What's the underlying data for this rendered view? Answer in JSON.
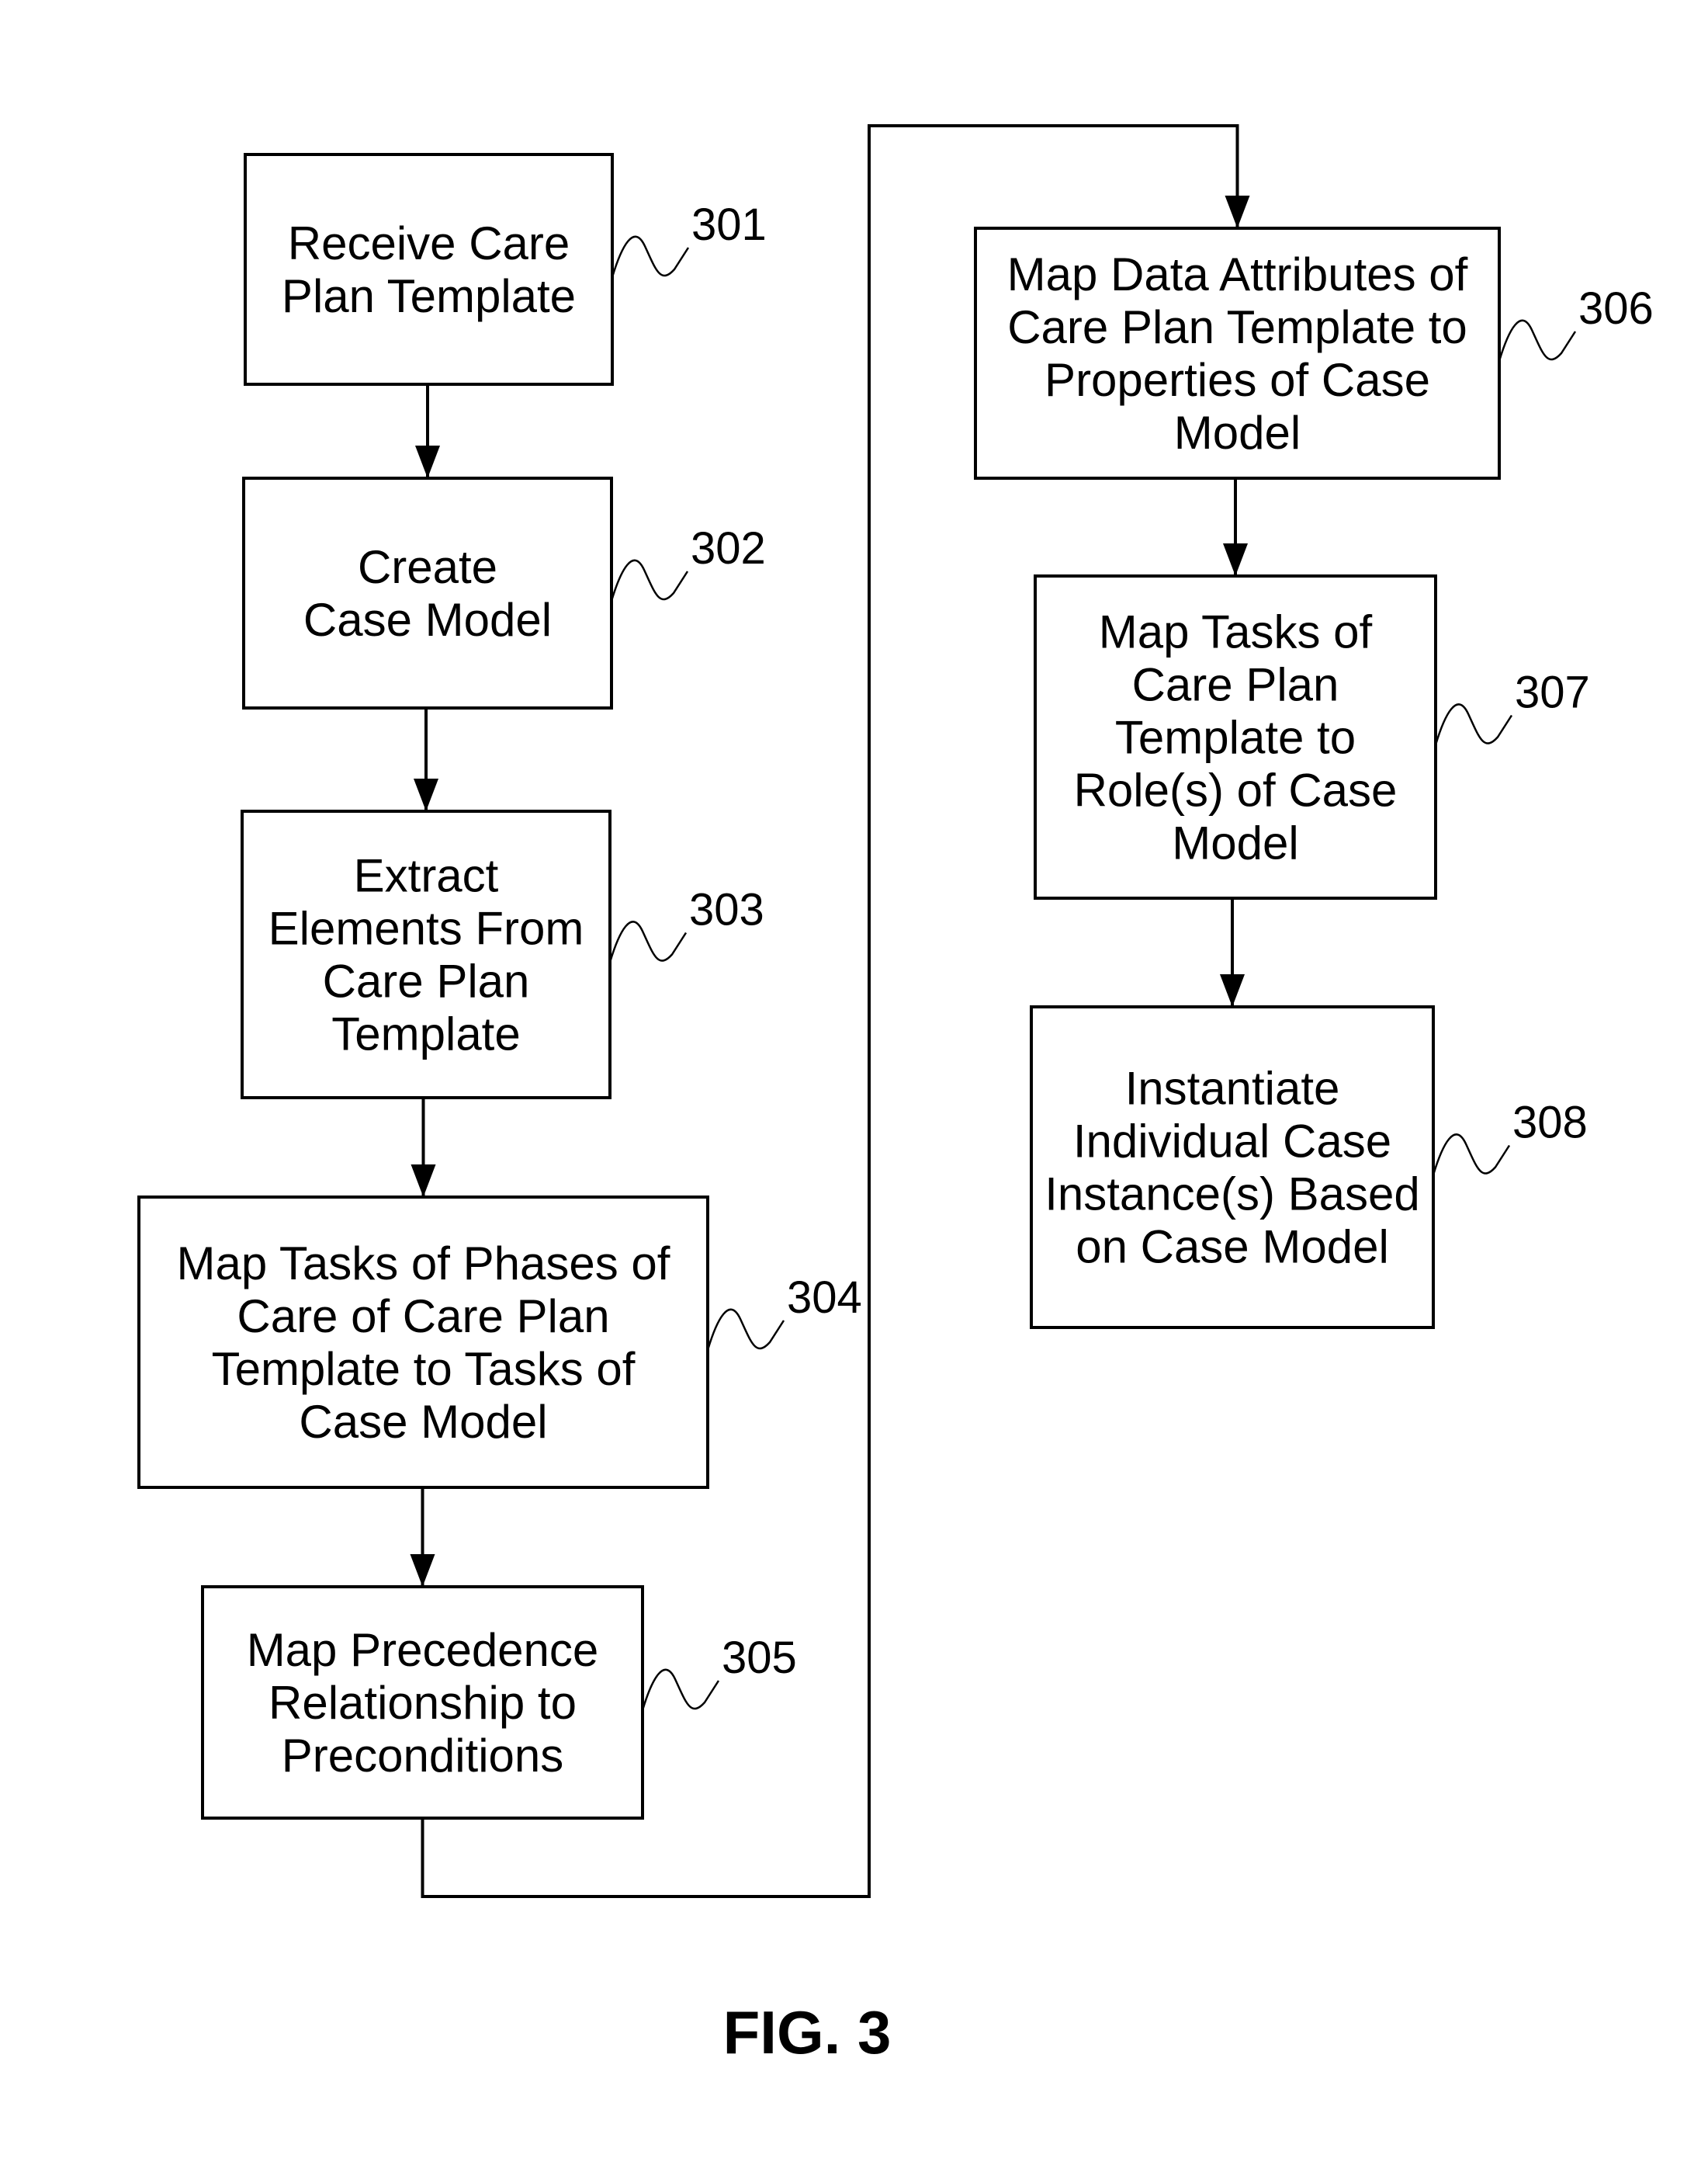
{
  "figure": {
    "label": "FIG.  3"
  },
  "steps": [
    {
      "id": "301",
      "ref": "301",
      "lines": [
        "Receive Care",
        "Plan Template"
      ]
    },
    {
      "id": "302",
      "ref": "302",
      "lines": [
        "Create",
        "Case Model"
      ]
    },
    {
      "id": "303",
      "ref": "303",
      "lines": [
        "Extract",
        "Elements From",
        "Care Plan",
        "Template"
      ]
    },
    {
      "id": "304",
      "ref": "304",
      "lines": [
        "Map Tasks of Phases of",
        "Care of Care Plan",
        "Template to Tasks of",
        "Case Model"
      ]
    },
    {
      "id": "305",
      "ref": "305",
      "lines": [
        "Map Precedence",
        "Relationship to",
        "Preconditions"
      ]
    },
    {
      "id": "306",
      "ref": "306",
      "lines": [
        "Map Data Attributes of",
        "Care Plan Template to",
        "Properties of Case",
        "Model"
      ]
    },
    {
      "id": "307",
      "ref": "307",
      "lines": [
        "Map Tasks of",
        "Care Plan",
        "Template to",
        "Role(s) of Case",
        "Model"
      ]
    },
    {
      "id": "308",
      "ref": "308",
      "lines": [
        "Instantiate",
        "Individual Case",
        "Instance(s) Based",
        "on Case Model"
      ]
    }
  ],
  "flow": [
    {
      "from": "301",
      "to": "302"
    },
    {
      "from": "302",
      "to": "303"
    },
    {
      "from": "303",
      "to": "304"
    },
    {
      "from": "304",
      "to": "305"
    },
    {
      "from": "305",
      "to": "306"
    },
    {
      "from": "306",
      "to": "307"
    },
    {
      "from": "307",
      "to": "308"
    }
  ]
}
